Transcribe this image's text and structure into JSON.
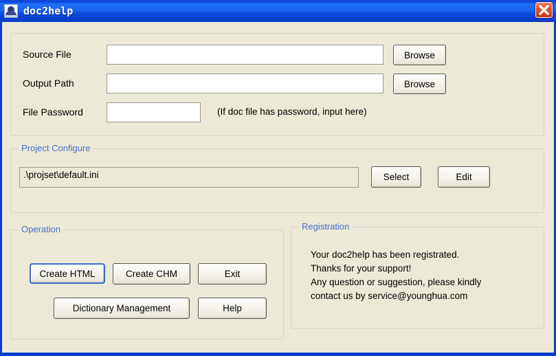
{
  "window": {
    "title": "doc2help",
    "icon": "app-icon",
    "close_label": "x",
    "colors": {
      "titlebar_blue": "#1a63f0",
      "frame_blue": "#0a3ecb",
      "client_bg": "#ece9d8",
      "group_label_blue": "#4a6fc4",
      "close_red": "#e4502a",
      "default_button_border": "#3b6bbf"
    }
  },
  "file_section": {
    "source_file": {
      "label": "Source File",
      "value": "",
      "placeholder": "",
      "browse_label": "Browse"
    },
    "output_path": {
      "label": "Output Path",
      "value": "",
      "placeholder": "",
      "browse_label": "Browse"
    },
    "file_password": {
      "label": "File Password",
      "value": "",
      "placeholder": "",
      "hint": "(If doc file has password, input here)"
    }
  },
  "project_configure": {
    "title": "Project Configure",
    "config_path": ".\\projset\\default.ini",
    "select_label": "Select",
    "edit_label": "Edit"
  },
  "operation": {
    "title": "Operation",
    "buttons": [
      {
        "label": "Create HTML",
        "default": true
      },
      {
        "label": "Create CHM",
        "default": false
      },
      {
        "label": "Exit",
        "default": false
      },
      {
        "label": "Dictionary Management",
        "default": false
      },
      {
        "label": "Help",
        "default": false
      }
    ]
  },
  "registration": {
    "title": "Registration",
    "lines": [
      "Your doc2help has been registrated.",
      "Thanks for your support!",
      "Any question or suggestion, please kindly",
      "contact us by service@younghua.com"
    ]
  }
}
